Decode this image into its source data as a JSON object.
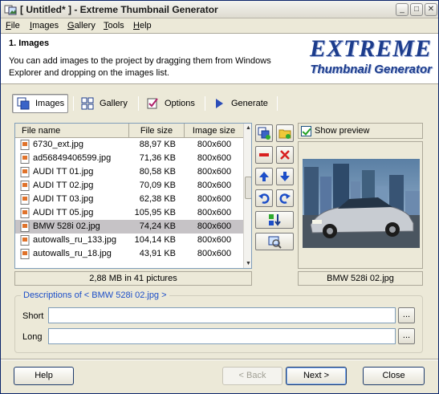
{
  "window": {
    "title": "[ Untitled* ] - Extreme Thumbnail Generator",
    "minimize": "_",
    "maximize": "□",
    "close": "✕"
  },
  "menu": [
    {
      "label": "File",
      "underline": "F",
      "rest": "ile"
    },
    {
      "label": "Images",
      "underline": "I",
      "rest": "mages"
    },
    {
      "label": "Gallery",
      "underline": "G",
      "rest": "allery"
    },
    {
      "label": "Tools",
      "underline": "T",
      "rest": "ools"
    },
    {
      "label": "Help",
      "underline": "H",
      "rest": "elp"
    }
  ],
  "header": {
    "title": "1. Images",
    "description": "You can add images to the project by dragging them from Windows Explorer and dropping on the images list.",
    "logo_line1": "EXTREME",
    "logo_line2": "Thumbnail Generator"
  },
  "tabs": [
    {
      "label": "Images",
      "icon": "images-icon",
      "active": true
    },
    {
      "label": "Gallery",
      "icon": "gallery-grid-icon",
      "active": false
    },
    {
      "label": "Options",
      "icon": "options-checklist-icon",
      "active": false
    },
    {
      "label": "Generate",
      "icon": "generate-play-icon",
      "active": false
    }
  ],
  "file_list": {
    "columns": [
      "File name",
      "File size",
      "Image size"
    ],
    "rows": [
      {
        "name": "6730_ext.jpg",
        "size": "88,97 KB",
        "image_size": "800x600"
      },
      {
        "name": "ad56849406599.jpg",
        "size": "71,36 KB",
        "image_size": "800x600"
      },
      {
        "name": "AUDI TT 01.jpg",
        "size": "80,58 KB",
        "image_size": "800x600"
      },
      {
        "name": "AUDI TT 02.jpg",
        "size": "70,09 KB",
        "image_size": "800x600"
      },
      {
        "name": "AUDI TT 03.jpg",
        "size": "62,38 KB",
        "image_size": "800x600"
      },
      {
        "name": "AUDI TT 05.jpg",
        "size": "105,95 KB",
        "image_size": "800x600"
      },
      {
        "name": "BMW 528i 02.jpg",
        "size": "74,24 KB",
        "image_size": "800x600",
        "selected": true
      },
      {
        "name": "autowalls_ru_133.jpg",
        "size": "104,14 KB",
        "image_size": "800x600"
      },
      {
        "name": "autowalls_ru_18.jpg",
        "size": "43,91 KB",
        "image_size": "800x600"
      }
    ],
    "status": "2,88 MB in 41 pictures"
  },
  "actions": [
    {
      "name": "add-images-button",
      "icon": "add-images-icon"
    },
    {
      "name": "add-folder-button",
      "icon": "add-folder-icon"
    },
    {
      "name": "remove-button",
      "icon": "minus-icon"
    },
    {
      "name": "clear-button",
      "icon": "red-x-icon"
    },
    {
      "name": "move-up-button",
      "icon": "arrow-up-icon"
    },
    {
      "name": "move-down-button",
      "icon": "arrow-down-icon"
    },
    {
      "name": "rotate-left-button",
      "icon": "rotate-left-icon"
    },
    {
      "name": "rotate-right-button",
      "icon": "rotate-right-icon"
    },
    {
      "name": "sort-button",
      "icon": "sort-icon"
    },
    {
      "name": "view-image-button",
      "icon": "view-image-icon"
    }
  ],
  "preview": {
    "show_label": "Show preview",
    "checked": true,
    "caption": "BMW 528i 02.jpg"
  },
  "descriptions": {
    "legend": "Descriptions of < BMW 528i 02.jpg >",
    "short_label": "Short",
    "long_label": "Long",
    "short_value": "",
    "long_value": "",
    "browse_label": "..."
  },
  "buttons": {
    "help": "Help",
    "back": "< Back",
    "next": "Next >",
    "close": "Close"
  },
  "colors": {
    "accent": "#1c3c8c",
    "legend": "#1c4ec8",
    "selected_row": "#c6c3c6"
  }
}
